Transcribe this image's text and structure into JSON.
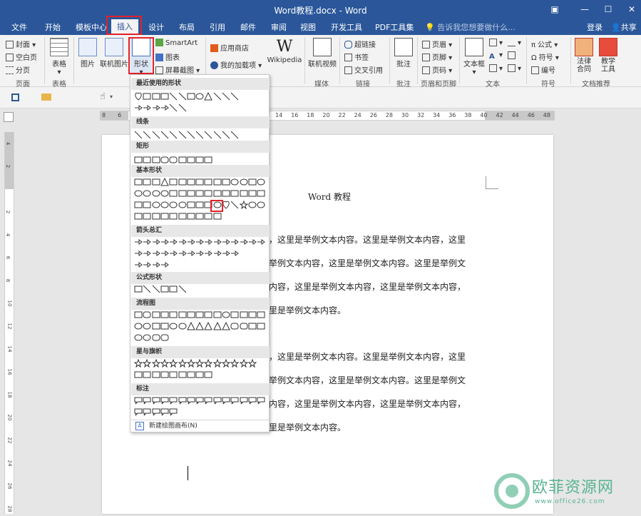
{
  "window": {
    "title": "Word教程.docx - Word",
    "controls": [
      "▣",
      "—",
      "☐",
      "✕"
    ]
  },
  "tabs": [
    {
      "label": "文件"
    },
    {
      "label": "开始"
    },
    {
      "label": "模板中心"
    },
    {
      "label": "插入"
    },
    {
      "label": "设计"
    },
    {
      "label": "布局"
    },
    {
      "label": "引用"
    },
    {
      "label": "邮件"
    },
    {
      "label": "审阅"
    },
    {
      "label": "视图"
    },
    {
      "label": "开发工具"
    },
    {
      "label": "PDF工具集"
    }
  ],
  "tell_me": "告诉我您想要做什么...",
  "account": {
    "login": "登录",
    "share": "共享"
  },
  "ribbon": {
    "pages": {
      "cover": "封面",
      "blank": "空白页",
      "break": "分页",
      "group": "页面"
    },
    "table": {
      "label": "表格",
      "group": "表格"
    },
    "illustrations": {
      "picture": "图片",
      "online_picture": "联机图片",
      "shapes": "形状",
      "smartart": "SmartArt",
      "chart": "图表",
      "screenshot": "屏幕截图"
    },
    "addins": {
      "store": "应用商店",
      "my_addins": "我的加载项",
      "wikipedia": "Wikipedia"
    },
    "media": {
      "online_video": "联机视频",
      "group": "媒体"
    },
    "links": {
      "hyperlink": "超链接",
      "bookmark": "书签",
      "crossref": "交叉引用",
      "group": "链接"
    },
    "comments": {
      "comment": "批注",
      "group": "批注"
    },
    "header_footer": {
      "header": "页眉",
      "footer": "页脚",
      "page_number": "页码",
      "group": "页眉和页脚"
    },
    "text": {
      "textbox": "文本框",
      "group": "文本"
    },
    "symbols": {
      "equation": "公式",
      "symbol": "符号",
      "number": "编号",
      "group": "符号"
    },
    "recommend": {
      "law": "法律合同",
      "teach": "教学工具",
      "group": "文档推荐"
    }
  },
  "ruler": {
    "h_ticks": [
      "8",
      "6",
      "4",
      "2",
      "",
      "2",
      "4",
      "6",
      "8",
      "10",
      "12",
      "14",
      "16",
      "18",
      "20",
      "22",
      "24",
      "26",
      "28",
      "30",
      "32",
      "34",
      "36",
      "38",
      "40",
      "42",
      "44",
      "46",
      "48"
    ],
    "v_ticks": [
      "4",
      "2",
      "",
      "2",
      "4",
      "6",
      "8",
      "10",
      "12",
      "14",
      "16",
      "18",
      "20",
      "22",
      "24",
      "26",
      "28"
    ]
  },
  "document": {
    "title": "Word 教程",
    "lines": [
      "，这里是举例文本内容。这里是举例文本内容，这里",
      "举例文本内容，这里是举例文本内容。这里是举例文",
      "内容，这里是举例文本内容，这里是举例文本内容，",
      "里是举例文本内容。",
      "，这里是举例文本内容。这里是举例文本内容，这里",
      "举例文本内容，这里是举例文本内容。这里是举例文",
      "内容，这里是举例文本内容，这里是举例文本内容，",
      "里是举例文本内容。"
    ]
  },
  "shapes_menu": {
    "categories": [
      "最近使用的形状",
      "线条",
      "矩形",
      "基本形状",
      "箭头总汇",
      "公式形状",
      "流程图",
      "星与旗帜",
      "标注"
    ],
    "new_canvas": "新建绘图画布(N)"
  },
  "watermark": {
    "text": "欧菲资源网",
    "url": "www.office26.com"
  },
  "colors": {
    "brand": "#2b579a",
    "highlight": "#e3222b"
  }
}
